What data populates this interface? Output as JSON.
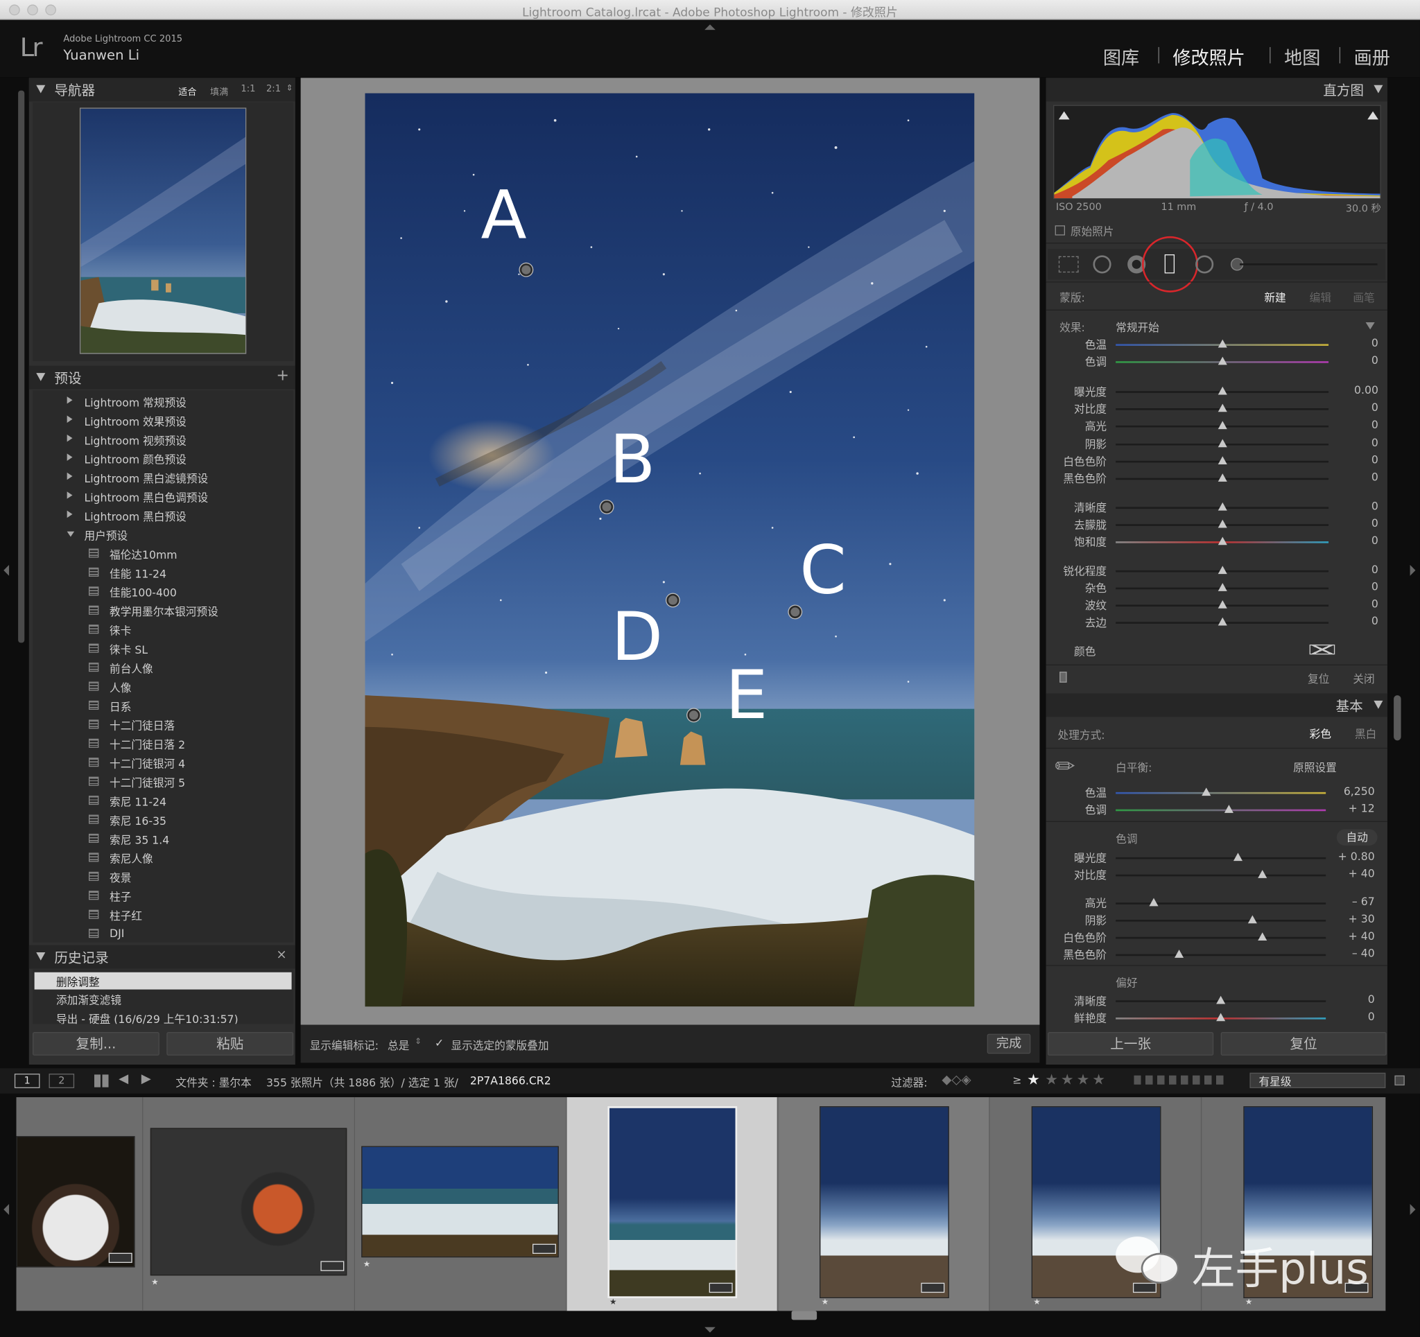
{
  "window": {
    "title": "Lightroom Catalog.lrcat - Adobe Photoshop Lightroom - 修改照片"
  },
  "identity": {
    "logo": "Lr",
    "version": "Adobe Lightroom CC 2015",
    "user": "Yuanwen Li"
  },
  "modules": [
    "图库",
    "修改照片",
    "地图",
    "画册"
  ],
  "active_module": "修改照片",
  "navigator": {
    "title": "导航器",
    "zoom_options": [
      "适合",
      "填满",
      "1:1",
      "2:1"
    ]
  },
  "presets": {
    "title": "预设",
    "add_label": "+",
    "folders": [
      "Lightroom 常规预设",
      "Lightroom 效果预设",
      "Lightroom 视频预设",
      "Lightroom 颜色预设",
      "Lightroom 黑白滤镜预设",
      "Lightroom 黑白色调预设",
      "Lightroom 黑白预设",
      "用户预设"
    ],
    "user_presets": [
      "福伦达10mm",
      "佳能 11-24",
      "佳能100-400",
      "教学用墨尔本银河预设",
      "徕卡",
      "徕卡 SL",
      "前台人像",
      "人像",
      "日系",
      "十二门徒日落",
      "十二门徒日落 2",
      "十二门徒银河 4",
      "十二门徒银河 5",
      "索尼 11-24",
      "索尼 16-35",
      "索尼 35 1.4",
      "索尼人像",
      "夜景",
      "柱子",
      "柱子红",
      "DJI"
    ]
  },
  "history": {
    "title": "历史记录",
    "close": "×",
    "items": [
      "删除调整",
      "添加渐变滤镜",
      "导出 - 硬盘 (16/6/29 上午10:31:57)"
    ]
  },
  "left_buttons": {
    "copy": "复制...",
    "paste": "粘贴"
  },
  "photo": {
    "markers": [
      "A",
      "B",
      "C",
      "D",
      "E"
    ]
  },
  "toolbar": {
    "show_label": "显示编辑标记:",
    "show_value": "总是",
    "overlay_label": "显示选定的蒙版叠加",
    "done": "完成"
  },
  "histogram": {
    "title": "直方图",
    "iso": "ISO 2500",
    "focal": "11 mm",
    "aperture": "ƒ / 4.0",
    "shutter": "30.0 秒",
    "original": "原始照片"
  },
  "mask": {
    "label": "蒙版:",
    "new": "新建",
    "edit": "编辑",
    "brush": "画笔",
    "effect_label": "效果:",
    "effect_value": "常规开始",
    "sliders": [
      {
        "label": "色温",
        "value": "0",
        "knob": 0.5
      },
      {
        "label": "色调",
        "value": "0",
        "knob": 0.5
      },
      {
        "label": "曝光度",
        "value": "0.00",
        "knob": 0.5
      },
      {
        "label": "对比度",
        "value": "0",
        "knob": 0.5
      },
      {
        "label": "高光",
        "value": "0",
        "knob": 0.5
      },
      {
        "label": "阴影",
        "value": "0",
        "knob": 0.5
      },
      {
        "label": "白色色阶",
        "value": "0",
        "knob": 0.5
      },
      {
        "label": "黑色色阶",
        "value": "0",
        "knob": 0.5
      },
      {
        "label": "清晰度",
        "value": "0",
        "knob": 0.5
      },
      {
        "label": "去朦胧",
        "value": "0",
        "knob": 0.5
      },
      {
        "label": "饱和度",
        "value": "0",
        "knob": 0.5
      },
      {
        "label": "锐化程度",
        "value": "0",
        "knob": 0.5
      },
      {
        "label": "杂色",
        "value": "0",
        "knob": 0.5
      },
      {
        "label": "波纹",
        "value": "0",
        "knob": 0.5
      },
      {
        "label": "去边",
        "value": "0",
        "knob": 0.5
      }
    ],
    "color_label": "颜色",
    "reset": "复位",
    "close": "关闭"
  },
  "basic": {
    "title": "基本",
    "treatment_label": "处理方式:",
    "color": "彩色",
    "bw": "黑白",
    "wb_label": "白平衡:",
    "wb_value": "原照设置",
    "wb_sliders": [
      {
        "label": "色温",
        "value": "6,250",
        "knob": 0.43
      },
      {
        "label": "色调",
        "value": "+ 12",
        "knob": 0.54
      }
    ],
    "tone_label": "色调",
    "auto": "自动",
    "tone_sliders": [
      {
        "label": "曝光度",
        "value": "+ 0.80",
        "knob": 0.58
      },
      {
        "label": "对比度",
        "value": "+ 40",
        "knob": 0.7
      }
    ],
    "tone2_sliders": [
      {
        "label": "高光",
        "value": "– 67",
        "knob": 0.18
      },
      {
        "label": "阴影",
        "value": "+ 30",
        "knob": 0.65
      },
      {
        "label": "白色色阶",
        "value": "+ 40",
        "knob": 0.7
      },
      {
        "label": "黑色色阶",
        "value": "– 40",
        "knob": 0.3
      }
    ],
    "presence_label": "偏好",
    "presence_sliders": [
      {
        "label": "清晰度",
        "value": "0",
        "knob": 0.5
      },
      {
        "label": "鲜艳度",
        "value": "0",
        "knob": 0.5
      }
    ]
  },
  "right_buttons": {
    "prev": "上一张",
    "reset": "复位"
  },
  "filmbar": {
    "screen1": "1",
    "screen2": "2",
    "source": "文件夹 : 墨尔本",
    "count": "355 张照片（共 1886 张）/ 选定 1 张/",
    "filename": "2P7A1866.CR2",
    "filter_label": "过滤器:",
    "rating_op": "≥",
    "filter_value": "有星级"
  },
  "watermark": {
    "text": "左手plus"
  },
  "colors": {
    "panel": "#303030",
    "background": "#0d0d0d",
    "accent_red": "#d9262b"
  }
}
